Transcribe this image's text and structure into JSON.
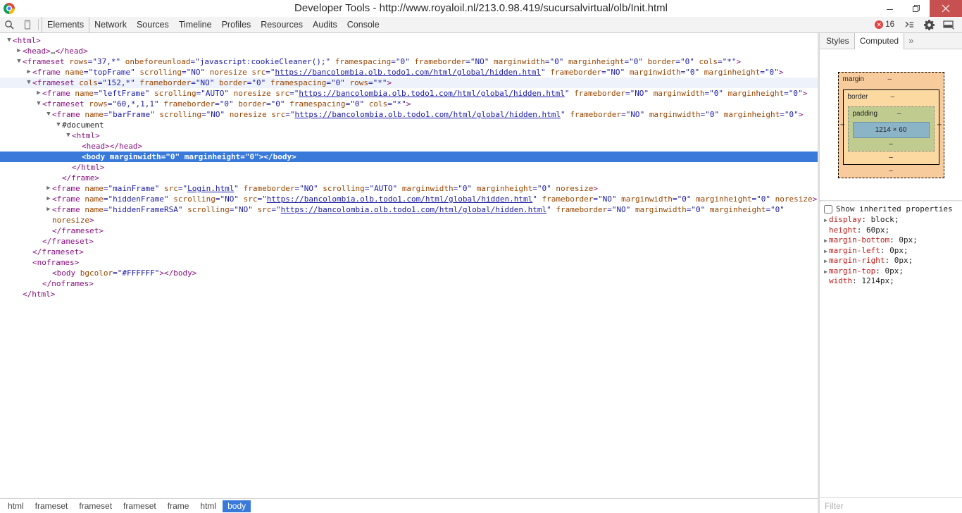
{
  "window": {
    "title": "Developer Tools - http://www.royaloil.nl/213.0.98.419/sucursalvirtual/olb/Init.html",
    "minimize_label": "–",
    "restore_label": "❐",
    "close_label": "✕"
  },
  "toolbar": {
    "inspect_icon": "search-icon",
    "device_icon": "device-toggle-icon",
    "tabs": [
      {
        "label": "Elements",
        "active": true
      },
      {
        "label": "Network",
        "active": false
      },
      {
        "label": "Sources",
        "active": false
      },
      {
        "label": "Timeline",
        "active": false
      },
      {
        "label": "Profiles",
        "active": false
      },
      {
        "label": "Resources",
        "active": false
      },
      {
        "label": "Audits",
        "active": false
      },
      {
        "label": "Console",
        "active": false
      }
    ],
    "error_badge": {
      "symbol": "✕",
      "count": "16"
    },
    "console_drawer_icon": "console-drawer-icon",
    "settings_icon": "gear-icon",
    "dock_icon": "dock-position-icon"
  },
  "dom_tree": {
    "nodes": [
      {
        "indent": 0,
        "twisty": "▼",
        "kind": "open",
        "tag": "html",
        "attrs": []
      },
      {
        "indent": 1,
        "twisty": "▶",
        "kind": "collapsed",
        "tag": "head",
        "attrs": [],
        "collapsed_text": "…"
      },
      {
        "indent": 1,
        "twisty": "▼",
        "kind": "open",
        "tag": "frameset",
        "attrs": [
          {
            "name": "rows",
            "value": "37,*"
          },
          {
            "name": "onbeforeunload",
            "value": "javascript:cookieCleaner();"
          },
          {
            "name": "framespacing",
            "value": "0"
          },
          {
            "name": "frameborder",
            "value": "NO"
          },
          {
            "name": "marginwidth",
            "value": "0"
          },
          {
            "name": "marginheight",
            "value": "0"
          },
          {
            "name": "border",
            "value": "0"
          },
          {
            "name": "cols",
            "value": "*"
          }
        ]
      },
      {
        "indent": 2,
        "twisty": "▶",
        "kind": "open",
        "tag": "frame",
        "attrs": [
          {
            "name": "name",
            "value": "topFrame"
          },
          {
            "name": "scrolling",
            "value": "NO"
          },
          {
            "name": "noresize",
            "value": null
          },
          {
            "name": "src",
            "value": "https://bancolombia.olb.todo1.com/html/global/hidden.html",
            "link": true
          },
          {
            "name": "frameborder",
            "value": "NO"
          },
          {
            "name": "marginwidth",
            "value": "0"
          },
          {
            "name": "marginheight",
            "value": "0"
          }
        ]
      },
      {
        "indent": 2,
        "twisty": "▼",
        "kind": "open",
        "tag": "frameset",
        "highlight": true,
        "attrs": [
          {
            "name": "cols",
            "value": "152,*"
          },
          {
            "name": "frameborder",
            "value": "NO"
          },
          {
            "name": "border",
            "value": "0"
          },
          {
            "name": "framespacing",
            "value": "0"
          },
          {
            "name": "rows",
            "value": "*"
          }
        ]
      },
      {
        "indent": 3,
        "twisty": "▶",
        "kind": "open",
        "tag": "frame",
        "attrs": [
          {
            "name": "name",
            "value": "leftFrame"
          },
          {
            "name": "scrolling",
            "value": "AUTO"
          },
          {
            "name": "noresize",
            "value": null
          },
          {
            "name": "src",
            "value": "https://bancolombia.olb.todo1.com/html/global/hidden.html",
            "link": true
          },
          {
            "name": "frameborder",
            "value": "NO"
          },
          {
            "name": "marginwidth",
            "value": "0"
          },
          {
            "name": "marginheight",
            "value": "0"
          }
        ]
      },
      {
        "indent": 3,
        "twisty": "▼",
        "kind": "open",
        "tag": "frameset",
        "attrs": [
          {
            "name": "rows",
            "value": "60,*,1,1"
          },
          {
            "name": "frameborder",
            "value": "0"
          },
          {
            "name": "border",
            "value": "0"
          },
          {
            "name": "framespacing",
            "value": "0"
          },
          {
            "name": "cols",
            "value": "*"
          }
        ]
      },
      {
        "indent": 4,
        "twisty": "▼",
        "kind": "open",
        "tag": "frame",
        "attrs": [
          {
            "name": "name",
            "value": "barFrame"
          },
          {
            "name": "scrolling",
            "value": "NO"
          },
          {
            "name": "noresize",
            "value": null
          },
          {
            "name": "src",
            "value": "https://bancolombia.olb.todo1.com/html/global/hidden.html",
            "link": true
          },
          {
            "name": "frameborder",
            "value": "NO"
          },
          {
            "name": "marginwidth",
            "value": "0"
          },
          {
            "name": "marginheight",
            "value": "0"
          }
        ]
      },
      {
        "indent": 5,
        "twisty": "▼",
        "kind": "document",
        "text": "#document"
      },
      {
        "indent": 6,
        "twisty": "▼",
        "kind": "open",
        "tag": "html",
        "attrs": []
      },
      {
        "indent": 7,
        "twisty": "",
        "kind": "pair",
        "tag": "head",
        "attrs": []
      },
      {
        "indent": 7,
        "twisty": "",
        "kind": "pair",
        "tag": "body",
        "selected": true,
        "attrs": [
          {
            "name": "marginwidth",
            "value": "0"
          },
          {
            "name": "marginheight",
            "value": "0"
          }
        ]
      },
      {
        "indent": 6,
        "twisty": "",
        "kind": "close",
        "tag": "html"
      },
      {
        "indent": 5,
        "twisty": "",
        "kind": "close",
        "tag": "frame"
      },
      {
        "indent": 4,
        "twisty": "▶",
        "kind": "open",
        "tag": "frame",
        "attrs": [
          {
            "name": "name",
            "value": "mainFrame"
          },
          {
            "name": "src",
            "value": "Login.html",
            "link": true
          },
          {
            "name": "frameborder",
            "value": "NO"
          },
          {
            "name": "scrolling",
            "value": "AUTO"
          },
          {
            "name": "marginwidth",
            "value": "0"
          },
          {
            "name": "marginheight",
            "value": "0"
          },
          {
            "name": "noresize",
            "value": null
          }
        ]
      },
      {
        "indent": 4,
        "twisty": "▶",
        "kind": "open",
        "tag": "frame",
        "attrs": [
          {
            "name": "name",
            "value": "hiddenFrame"
          },
          {
            "name": "scrolling",
            "value": "NO"
          },
          {
            "name": "src",
            "value": "https://bancolombia.olb.todo1.com/html/global/hidden.html",
            "link": true
          },
          {
            "name": "frameborder",
            "value": "NO"
          },
          {
            "name": "marginwidth",
            "value": "0"
          },
          {
            "name": "marginheight",
            "value": "0"
          },
          {
            "name": "noresize",
            "value": null
          }
        ]
      },
      {
        "indent": 4,
        "twisty": "▶",
        "kind": "open",
        "tag": "frame",
        "no_close": true,
        "attrs": [
          {
            "name": "name",
            "value": "hiddenFrameRSA"
          },
          {
            "name": "scrolling",
            "value": "NO"
          },
          {
            "name": "src",
            "value": "https://bancolombia.olb.todo1.com/html/global/hidden.html",
            "link": true
          },
          {
            "name": "frameborder",
            "value": "NO"
          },
          {
            "name": "marginwidth",
            "value": "0"
          },
          {
            "name": "marginheight",
            "value": "0"
          }
        ]
      },
      {
        "indent": 4,
        "twisty": "",
        "kind": "wrap",
        "text": "noresize",
        "tail": ">"
      },
      {
        "indent": 4,
        "twisty": "",
        "kind": "close",
        "tag": "frameset"
      },
      {
        "indent": 3,
        "twisty": "",
        "kind": "close",
        "tag": "frameset"
      },
      {
        "indent": 2,
        "twisty": "",
        "kind": "close",
        "tag": "frameset"
      },
      {
        "indent": 2,
        "twisty": "",
        "kind": "open",
        "tag": "noframes",
        "attrs": []
      },
      {
        "indent": 4,
        "twisty": "",
        "kind": "pair",
        "tag": "body",
        "attrs": [
          {
            "name": "bgcolor",
            "value": "#FFFFFF"
          }
        ]
      },
      {
        "indent": 3,
        "twisty": "",
        "kind": "close",
        "tag": "noframes"
      },
      {
        "indent": 1,
        "twisty": "",
        "kind": "close",
        "tag": "html"
      }
    ]
  },
  "sidebar": {
    "tabs": [
      {
        "label": "Styles",
        "active": false
      },
      {
        "label": "Computed",
        "active": true
      }
    ],
    "more_label": "»",
    "box_model": {
      "margin_label": "margin",
      "margin_top": "–",
      "margin_right": "–",
      "margin_bottom": "–",
      "margin_left": "–",
      "border_label": "border",
      "border_top": "–",
      "border_right": "–",
      "border_bottom": "–",
      "border_left": "–",
      "padding_label": "padding",
      "padding_top": "–",
      "padding_right": "–",
      "padding_bottom": "–",
      "padding_left": "–",
      "content": "1214 × 60"
    },
    "show_inherited_label": "Show inherited properties",
    "show_inherited_checked": false,
    "properties": [
      {
        "expandable": true,
        "name": "display",
        "value": "block;"
      },
      {
        "expandable": false,
        "name": "height",
        "value": "60px;"
      },
      {
        "expandable": true,
        "name": "margin-bottom",
        "value": "0px;"
      },
      {
        "expandable": true,
        "name": "margin-left",
        "value": "0px;"
      },
      {
        "expandable": true,
        "name": "margin-right",
        "value": "0px;"
      },
      {
        "expandable": true,
        "name": "margin-top",
        "value": "0px;"
      },
      {
        "expandable": false,
        "name": "width",
        "value": "1214px;"
      }
    ],
    "filter_placeholder": "Filter",
    "filter_value": ""
  },
  "breadcrumb": {
    "items": [
      {
        "label": "html",
        "active": false
      },
      {
        "label": "frameset",
        "active": false
      },
      {
        "label": "frameset",
        "active": false
      },
      {
        "label": "frameset",
        "active": false
      },
      {
        "label": "frame",
        "active": false
      },
      {
        "label": "html",
        "active": false
      },
      {
        "label": "body",
        "active": true
      }
    ]
  },
  "colors": {
    "selection": "#3879d9",
    "tag": "#881280",
    "attr_name": "#994500",
    "attr_value": "#1a1aa6",
    "prop_name": "#c41a16",
    "error": "#e04343",
    "close_button": "#c75050"
  }
}
